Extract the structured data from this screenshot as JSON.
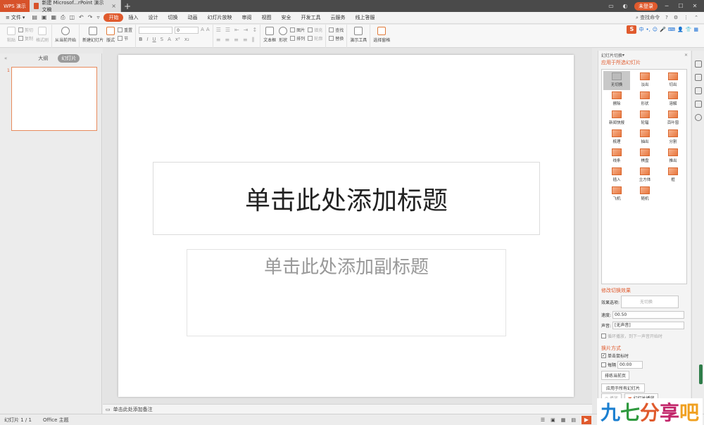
{
  "titlebar": {
    "app_name": "WPS 演示",
    "doc_tab": "新建 Microsof...rPoint 演示文稿",
    "new_tab": "+",
    "login": "未登录"
  },
  "menu": {
    "file": "文件",
    "tabs": [
      "开始",
      "插入",
      "设计",
      "切换",
      "动画",
      "幻灯片放映",
      "审阅",
      "视图",
      "安全",
      "开发工具",
      "云服务",
      "线上答服"
    ],
    "active_tab": "开始",
    "search": "查找命令"
  },
  "ribbon": {
    "paste": "粘贴",
    "cut": "剪切",
    "copy": "复制",
    "format_painter": "格式刷",
    "from_current": "从当前开始",
    "new_slide": "新建幻灯片",
    "layout": "版式",
    "reset": "重置",
    "section": "节",
    "font_size": "0",
    "textbox": "文本框",
    "shape": "形状",
    "arrange": "排列",
    "picture": "图片",
    "fill": "填充",
    "outline": "轮廓",
    "find": "查找",
    "replace": "替换",
    "presentation_tools": "演示工具",
    "select_pane": "选择窗格"
  },
  "left_panel": {
    "tab_outline": "大纲",
    "tab_slides": "幻灯片",
    "slide_number": "1"
  },
  "slide": {
    "title_placeholder": "单击此处添加标题",
    "subtitle_placeholder": "单击此处添加副标题"
  },
  "notes": "单击此处添加备注",
  "right_panel": {
    "title": "幻灯片切换",
    "apply_to_selected": "应用于所选幻灯片",
    "transitions": [
      "无切换",
      "淡出",
      "切出",
      "擦除",
      "形状",
      "溶解",
      "新闻快报",
      "轮辐",
      "百叶窗",
      "梳理",
      "抽出",
      "分割",
      "线条",
      "棋盘",
      "推出",
      "插入",
      "立方体",
      "框",
      "飞机",
      "随机"
    ],
    "selected_transition": "无切换",
    "modify_effect": "修改切换效果",
    "effect_option_label": "效果选项:",
    "effect_option_value": "无切换",
    "speed_label": "速度:",
    "speed_value": "00.50",
    "sound_label": "声音:",
    "sound_value": "[无声音]",
    "loop_label": "循环播放，到下一声音开始时",
    "advance_heading": "换片方式",
    "on_click": "单击鼠标时",
    "every": "每隔",
    "every_value": "00:00",
    "sort_current": "排练当前页",
    "apply_all": "应用于所有幻灯片",
    "play": "播放",
    "slideshow": "幻灯片播放"
  },
  "status": {
    "slide_count": "幻灯片 1 / 1",
    "theme": "Office 主题"
  },
  "watermark": [
    "九",
    "七",
    "分",
    "享",
    "吧"
  ],
  "colors": {
    "accent": "#e05a2d",
    "watermark": [
      "#1b7fd0",
      "#2f9a3f",
      "#e05a2d",
      "#c2256a",
      "#f0a020"
    ]
  }
}
